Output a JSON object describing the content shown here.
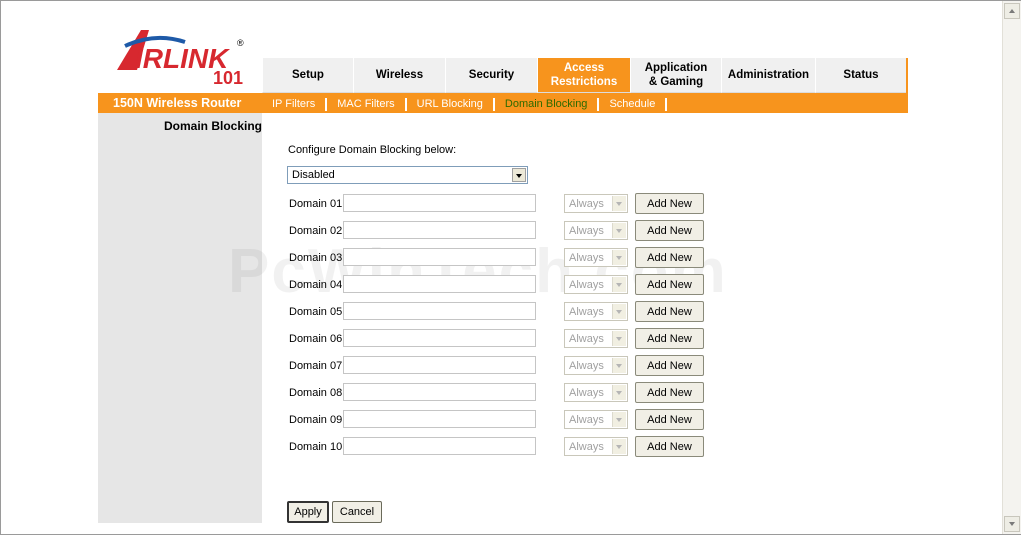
{
  "brand": {
    "logo_text_top": "AIRLINK",
    "logo_text_bottom": "101",
    "router_title": "150N Wireless Router",
    "brand_red": "#d7282f",
    "brand_blue": "#1e5aa8",
    "accent_orange": "#f7941d"
  },
  "tabs": [
    {
      "label": "Setup",
      "active": false
    },
    {
      "label": "Wireless",
      "active": false
    },
    {
      "label": "Security",
      "active": false
    },
    {
      "label": "Access Restrictions",
      "active": true
    },
    {
      "label": "Application & Gaming",
      "active": false
    },
    {
      "label": "Administration",
      "active": false
    },
    {
      "label": "Status",
      "active": false
    }
  ],
  "subtabs": [
    {
      "label": "IP Filters",
      "active": false
    },
    {
      "label": "MAC Filters",
      "active": false
    },
    {
      "label": "URL Blocking",
      "active": false
    },
    {
      "label": "Domain Blocking",
      "active": true
    },
    {
      "label": "Schedule",
      "active": false
    }
  ],
  "section_label": "Domain Blocking",
  "form": {
    "config_label": "Configure Domain Blocking below:",
    "mode_value": "Disabled",
    "domains": [
      {
        "label": "Domain 01:",
        "value": "",
        "schedule": "Always",
        "button": "Add New"
      },
      {
        "label": "Domain 02:",
        "value": "",
        "schedule": "Always",
        "button": "Add New"
      },
      {
        "label": "Domain 03:",
        "value": "",
        "schedule": "Always",
        "button": "Add New"
      },
      {
        "label": "Domain 04:",
        "value": "",
        "schedule": "Always",
        "button": "Add New"
      },
      {
        "label": "Domain 05:",
        "value": "",
        "schedule": "Always",
        "button": "Add New"
      },
      {
        "label": "Domain 06:",
        "value": "",
        "schedule": "Always",
        "button": "Add New"
      },
      {
        "label": "Domain 07:",
        "value": "",
        "schedule": "Always",
        "button": "Add New"
      },
      {
        "label": "Domain 08:",
        "value": "",
        "schedule": "Always",
        "button": "Add New"
      },
      {
        "label": "Domain 09:",
        "value": "",
        "schedule": "Always",
        "button": "Add New"
      },
      {
        "label": "Domain 10:",
        "value": "",
        "schedule": "Always",
        "button": "Add New"
      }
    ],
    "apply_label": "Apply",
    "cancel_label": "Cancel"
  },
  "watermark": "PcWinTech.com"
}
